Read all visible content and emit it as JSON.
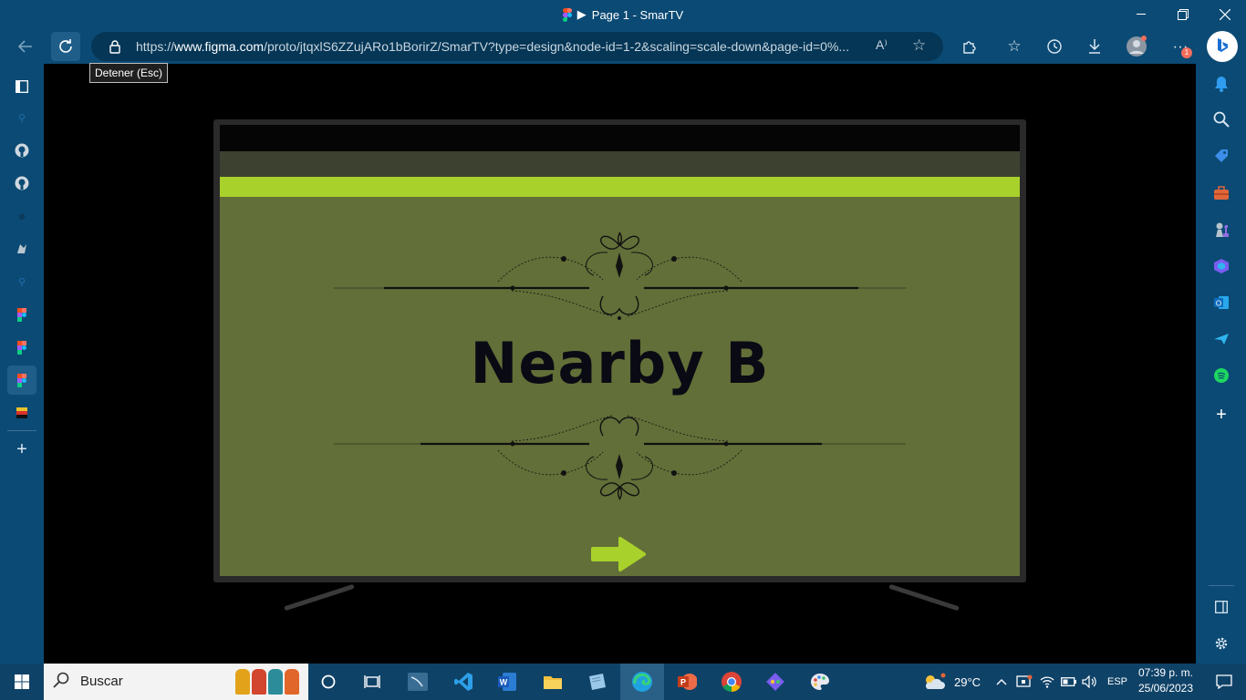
{
  "window": {
    "title": "Page 1 - SmarTV",
    "play_glyph": "▶"
  },
  "address_bar": {
    "url_prefix": "https://",
    "url_domain": "www.figma.com",
    "url_rest": "/proto/jtqxlS6ZZujARo1bBorirZ/SmarTV?type=design&node-id=1-2&scaling=scale-down&page-id=0%...",
    "read_aloud_glyph": "A⁾",
    "notification_badge": "1"
  },
  "tooltip": {
    "text": "Detener (Esc)"
  },
  "prototype": {
    "headline": "Nearby B",
    "colors": {
      "screen": "#626f38",
      "accent": "#a9d12b",
      "band": "#3d4230",
      "text": "#0a0a14"
    }
  },
  "taskbar": {
    "search_placeholder": "Buscar",
    "weather_temp": "29°C",
    "language": "ESP",
    "time": "07:39 p. m.",
    "date": "25/06/2023"
  }
}
